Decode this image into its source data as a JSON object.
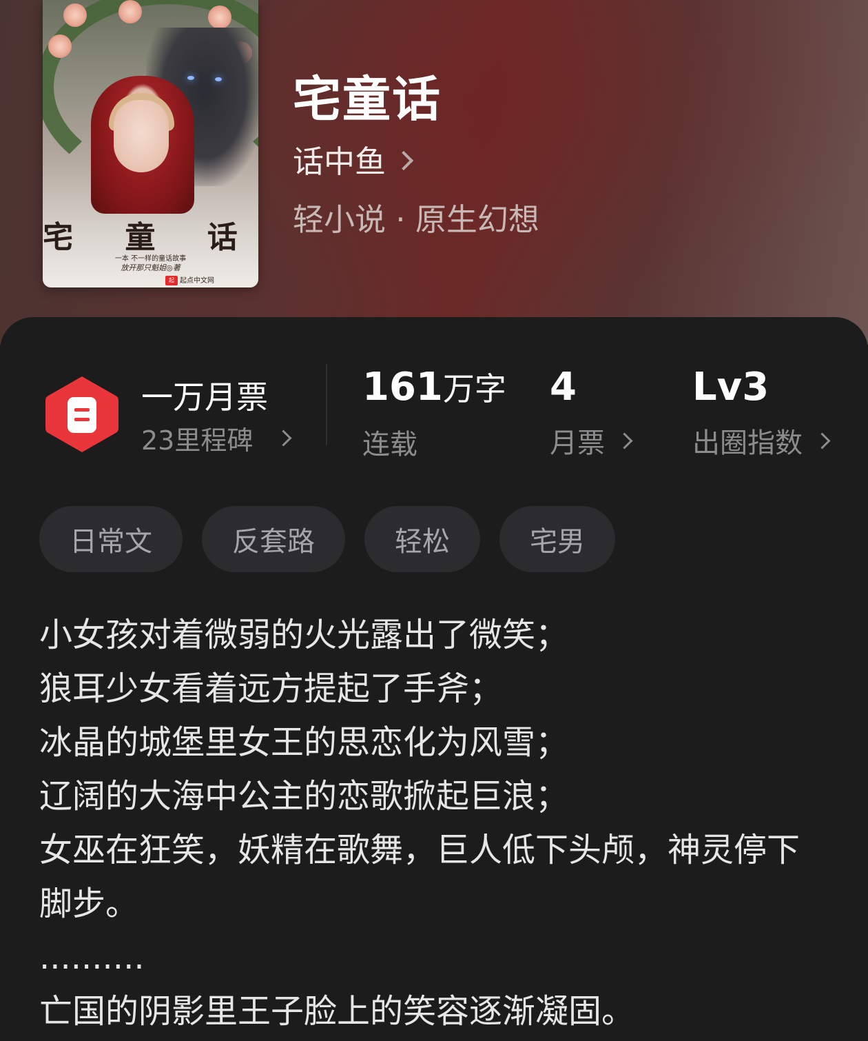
{
  "book": {
    "title": "宅童话",
    "author": "话中鱼",
    "category": "轻小说 · 原生幻想",
    "cover": {
      "title": "宅 童 话",
      "tagline": "一本 不一样的童话故事",
      "author_line": "放开那只魁姐◎著",
      "publisher": "起点中文网"
    }
  },
  "milestone": {
    "title": "一万月票",
    "subtitle": "23里程碑",
    "icon": "ticket-hexagon-icon",
    "color": "#e8363a"
  },
  "stats": [
    {
      "value": "161",
      "unit": "万字",
      "label": "连载",
      "has_chevron": false
    },
    {
      "value": "4",
      "unit": "",
      "label": "月票",
      "has_chevron": true
    },
    {
      "value": "Lv3",
      "unit": "",
      "label": "出圈指数",
      "has_chevron": true
    }
  ],
  "tags": [
    "日常文",
    "反套路",
    "轻松",
    "宅男"
  ],
  "synopsis": [
    "小女孩对着微弱的火光露出了微笑；",
    "狼耳少女看着远方提起了手斧；",
    "冰晶的城堡里女王的思恋化为风雪；",
    "辽阔的大海中公主的恋歌掀起巨浪；",
    "女巫在狂笑，妖精在歌舞，巨人低下头颅，神灵停下脚步。",
    "..........",
    "亡国的阴影里王子脸上的笑容逐渐凝固。"
  ]
}
